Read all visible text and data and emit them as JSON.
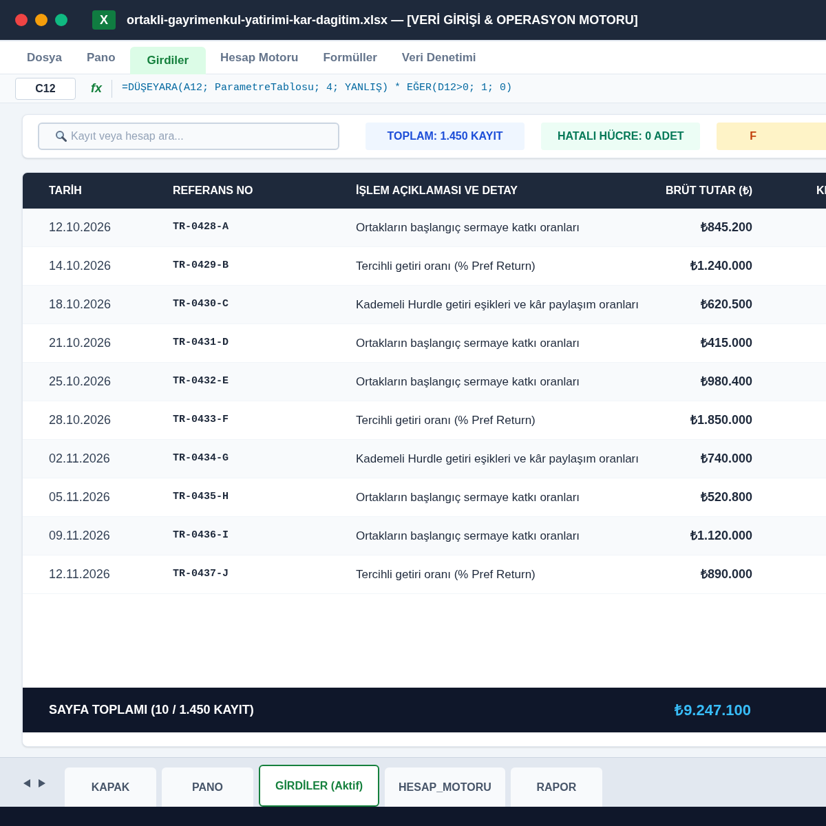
{
  "window": {
    "title": "ortakli-gayrimenkul-yatirimi-kar-dagitim.xlsx — [VERİ GİRİŞİ & OPERASYON MOTORU]",
    "app_icon_letter": "X"
  },
  "menu": [
    {
      "label": "Dosya",
      "selected": false
    },
    {
      "label": "Pano",
      "selected": false
    },
    {
      "label": "Girdiler",
      "selected": true
    },
    {
      "label": "Hesap Motoru",
      "selected": false
    },
    {
      "label": "Formüller",
      "selected": false
    },
    {
      "label": "Veri Denetimi",
      "selected": false
    }
  ],
  "formula_bar": {
    "cell": "C12",
    "fx": "fx",
    "formula": "=DÜŞEYARA(A12; ParametreTablosu; 4; YANLIŞ) * EĞER(D12>0; 1; 0)"
  },
  "search": {
    "placeholder": "Kayıt veya hesap ara..."
  },
  "badges": [
    {
      "label": "TOPLAM: 1.450 KAYIT",
      "kind": "info"
    },
    {
      "label": "HATALI HÜCRE: 0 ADET",
      "kind": "success"
    },
    {
      "label": "F",
      "kind": "warning"
    }
  ],
  "table": {
    "columns": [
      "TARİH",
      "REFERANS NO",
      "İŞLEM AÇIKLAMASI VE DETAY",
      "BRÜT TUTAR (₺)",
      "KI"
    ],
    "rows": [
      [
        "12.10.2026",
        "TR-0428-A",
        "Ortakların başlangıç sermaye katkı oranları",
        "₺845.200"
      ],
      [
        "14.10.2026",
        "TR-0429-B",
        "Tercihli getiri oranı (% Pref Return)",
        "₺1.240.000"
      ],
      [
        "18.10.2026",
        "TR-0430-C",
        "Kademeli Hurdle getiri eşikleri ve kâr paylaşım oranları",
        "₺620.500"
      ],
      [
        "21.10.2026",
        "TR-0431-D",
        "Ortakların başlangıç sermaye katkı oranları",
        "₺415.000"
      ],
      [
        "25.10.2026",
        "TR-0432-E",
        "Ortakların başlangıç sermaye katkı oranları",
        "₺980.400"
      ],
      [
        "28.10.2026",
        "TR-0433-F",
        "Tercihli getiri oranı (% Pref Return)",
        "₺1.850.000"
      ],
      [
        "02.11.2026",
        "TR-0434-G",
        "Kademeli Hurdle getiri eşikleri ve kâr paylaşım oranları",
        "₺740.000"
      ],
      [
        "05.11.2026",
        "TR-0435-H",
        "Ortakların başlangıç sermaye katkı oranları",
        "₺520.800"
      ],
      [
        "09.11.2026",
        "TR-0436-I",
        "Ortakların başlangıç sermaye katkı oranları",
        "₺1.120.000"
      ],
      [
        "12.11.2026",
        "TR-0437-J",
        "Tercihli getiri oranı (% Pref Return)",
        "₺890.000"
      ]
    ],
    "footer": {
      "label": "SAYFA TOPLAMI (10 / 1.450 KAYIT)",
      "total": "₺9.247.100"
    }
  },
  "sheet_tabs": [
    {
      "label": "KAPAK",
      "selected": false
    },
    {
      "label": "PANO",
      "selected": false
    },
    {
      "label": "GİRDİLER (Aktif)",
      "selected": true
    },
    {
      "label": "HESAP_MOTORU",
      "selected": false
    },
    {
      "label": "RAPOR",
      "selected": false
    }
  ]
}
